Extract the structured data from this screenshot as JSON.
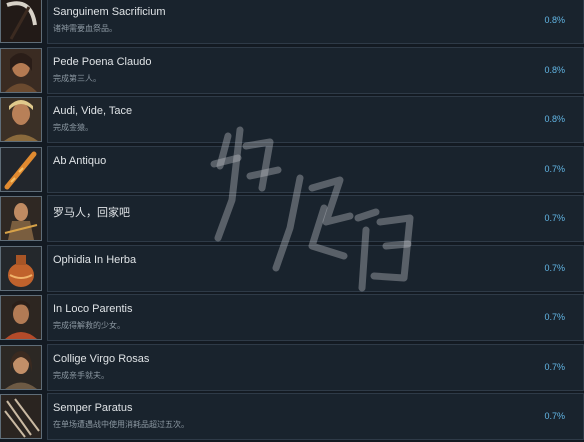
{
  "achievements": [
    {
      "title": "Sanguinem Sacrificium",
      "desc": "诸神需要血祭品。",
      "percent": "0.8%",
      "icon": "scythe-icon"
    },
    {
      "title": "Pede Poena Claudo",
      "desc": "完成第三人。",
      "percent": "0.8%",
      "icon": "warrior-portrait-icon"
    },
    {
      "title": "Audi, Vide, Tace",
      "desc": "完成金猿。",
      "percent": "0.8%",
      "icon": "bearded-man-portrait-icon"
    },
    {
      "title": "Ab Antiquo",
      "desc": "",
      "percent": "0.7%",
      "icon": "staff-icon"
    },
    {
      "title": "罗马人，回家吧",
      "desc": "",
      "percent": "0.7%",
      "icon": "figure-portrait-icon"
    },
    {
      "title": "Ophidia In Herba",
      "desc": "",
      "percent": "0.7%",
      "icon": "pottery-jar-icon"
    },
    {
      "title": "In Loco Parentis",
      "desc": "完成得解救的少女。",
      "percent": "0.7%",
      "icon": "man-portrait-icon"
    },
    {
      "title": "Collige Virgo Rosas",
      "desc": "完成亲手就夫。",
      "percent": "0.7%",
      "icon": "woman-portrait-icon"
    },
    {
      "title": "Semper Paratus",
      "desc": "在单场遭遇战中使用消耗品超过五次。",
      "percent": "0.7%",
      "icon": "weapons-icon"
    }
  ],
  "colors": {
    "background": "#131a22",
    "card": "#19232d",
    "percent": "#63b7e6"
  }
}
